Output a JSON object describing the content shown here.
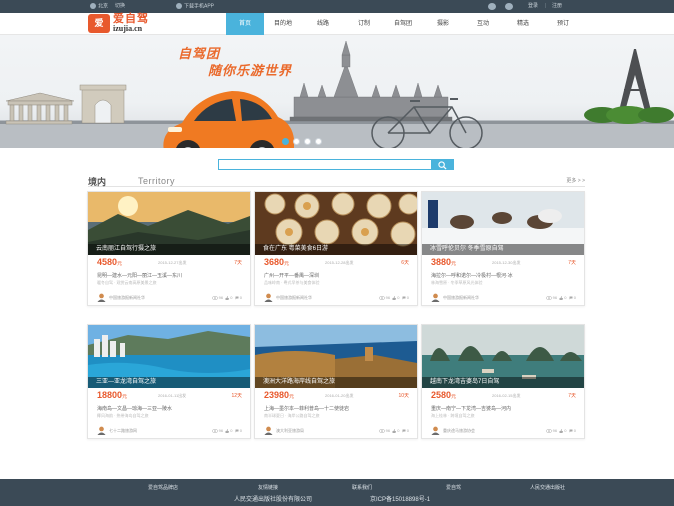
{
  "topbar": {
    "location": "北京",
    "switch": "切换",
    "app": "下载手机APP",
    "login": "登录",
    "register": "注册"
  },
  "logo": {
    "mark": "爱",
    "cn": "爱自驾",
    "en": "izujia.cn"
  },
  "nav": [
    "首页",
    "目的地",
    "线路",
    "订制",
    "自驾团",
    "摄影",
    "互动",
    "精选",
    "预订"
  ],
  "banner": {
    "slogan_line1": "自驾团",
    "slogan_line2": "随你乐游世界",
    "slides": 4,
    "active_slide": 1
  },
  "search": {
    "placeholder": ""
  },
  "section": {
    "title_cn": "境内",
    "title_en": "Territory",
    "more": "更多 > >"
  },
  "cards": [
    {
      "caption": "云南丽江自驾行摄之旅",
      "price": "4580",
      "price_unit": "元",
      "date": "2015-12-27出发",
      "days": "7天",
      "route": "昆明—建水—元阳—丽江—玉溪—东川",
      "desc": "暖冬自驾 · 观赏云南高原美景之旅",
      "author": "中国旅游报新闻社华",
      "views": "96",
      "likes": "0",
      "comments": "0"
    },
    {
      "caption": "食在广东 粤菜美食6日游",
      "price": "3680",
      "price_unit": "元",
      "date": "2015-12-28出发",
      "days": "6天",
      "route": "广州—开平—番禺—深圳",
      "desc": "品味岭南 · 粤式早茶与美食体验",
      "author": "中国旅游报新闻社华",
      "views": "96",
      "likes": "0",
      "comments": "0"
    },
    {
      "caption": "冰雪呼伦贝尔 冬季雪原自驾",
      "price": "3880",
      "price_unit": "元",
      "date": "2015-12-30出发",
      "days": "7天",
      "route": "海拉尔—呼和诺尔—冷极村—根河·冰",
      "desc": "林海雪原 · 冬季草原风光体验",
      "author": "中国旅游报新闻社华",
      "views": "96",
      "likes": "0",
      "comments": "0"
    },
    {
      "caption": "三亚—亚龙湾自驾之旅",
      "price": "18800",
      "price_unit": "元",
      "date": "2016-01-11出发",
      "days": "12天",
      "route": "海南岛—文昌—琼海—三亚—陵水",
      "desc": "椰风海韵 · 热带海岛自驾之旅",
      "author": "七十二路旅游网",
      "views": "96",
      "likes": "0",
      "comments": "0"
    },
    {
      "caption": "澳洲大洋路海岸线自驾之旅",
      "price": "23980",
      "price_unit": "元",
      "date": "2016-01-20出发",
      "days": "10天",
      "route": "上海—墨尔本—菲利普岛—十二使徒岩",
      "desc": "南半球夏日 · 海岸公路自驾之旅",
      "author": "澳大利亚旅游局",
      "views": "96",
      "likes": "0",
      "comments": "0"
    },
    {
      "caption": "越南下龙湾吉婆岛7日自驾",
      "price": "2580",
      "price_unit": "元",
      "date": "2016-02-15出发",
      "days": "7天",
      "route": "重庆—南宁—下龙湾—吉婆岛—河内",
      "desc": "海上桂林 · 跨境自驾之旅",
      "author": "重庆途马旅游协会",
      "views": "96",
      "likes": "0",
      "comments": "0"
    }
  ],
  "footer": {
    "links": [
      "爱自驾品牌店",
      "友情链接",
      "联系我们",
      "爱自驾",
      "人民交通出版社"
    ],
    "company": "人民交通出版社股份有限公司",
    "icp": "京ICP备15018898号-1"
  },
  "colors": {
    "accent": "#4ab3dc",
    "brand": "#e8592d",
    "dark": "#3b4a56"
  }
}
